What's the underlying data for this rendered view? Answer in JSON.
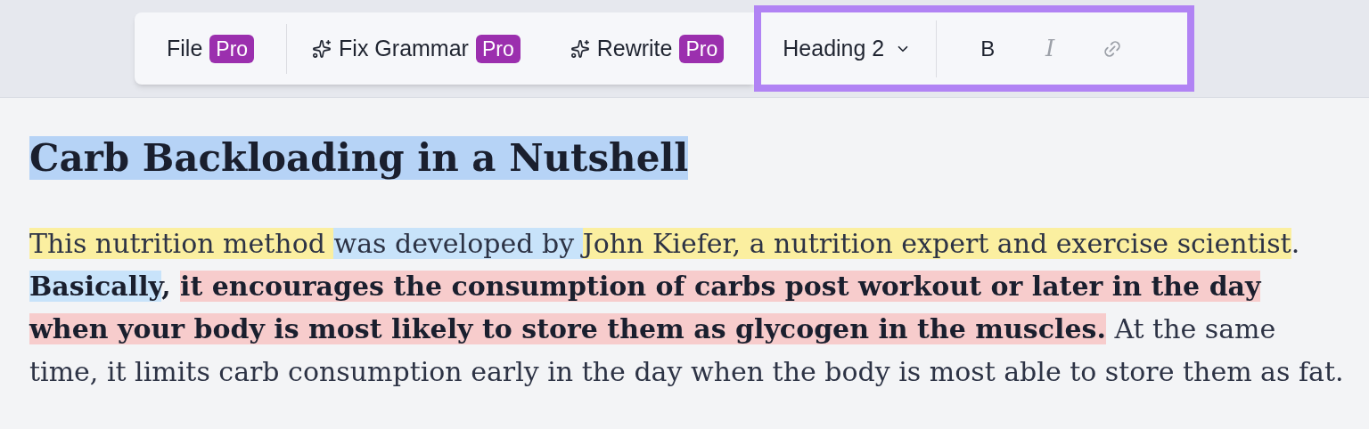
{
  "toolbar": {
    "actions": [
      {
        "label": "File",
        "badge": "Pro",
        "sparkle": false
      },
      {
        "label": "Fix Grammar",
        "badge": "Pro",
        "sparkle": true
      },
      {
        "label": "Rewrite",
        "badge": "Pro",
        "sparkle": true
      }
    ],
    "highlighted_group": {
      "block_style": "Heading 2",
      "format_buttons": [
        {
          "kind": "bold",
          "label": "B",
          "disabled": false
        },
        {
          "kind": "italic",
          "label": "I",
          "disabled": true
        },
        {
          "kind": "link",
          "disabled": true
        }
      ]
    }
  },
  "document": {
    "heading": {
      "text": "Carb Backloading in a Nutshell",
      "color": "#b6d3f6"
    },
    "paragraph": [
      {
        "text": "This nutrition method ",
        "color": "#fbefa0",
        "bold": false
      },
      {
        "text": "was developed by ",
        "color": "#c8e3fa",
        "bold": false
      },
      {
        "text": "John Kiefer, a nutrition expert and exercise scientist",
        "color": "#fbefa0",
        "bold": false
      },
      {
        "text": ". ",
        "bold": false
      },
      {
        "text": "Basically",
        "color": "#c8e3fa",
        "bold": true
      },
      {
        "text": ", ",
        "bold": true
      },
      {
        "text": "it encourages the consumption of carbs post workout or later in the day when your body is most likely to store them as glycogen in the muscles.",
        "color": "#f7cccc",
        "bold": true
      },
      {
        "text": " At the same time, it limits carb consumption early in the day when the body is most able to store them as fat.",
        "bold": false
      }
    ]
  }
}
